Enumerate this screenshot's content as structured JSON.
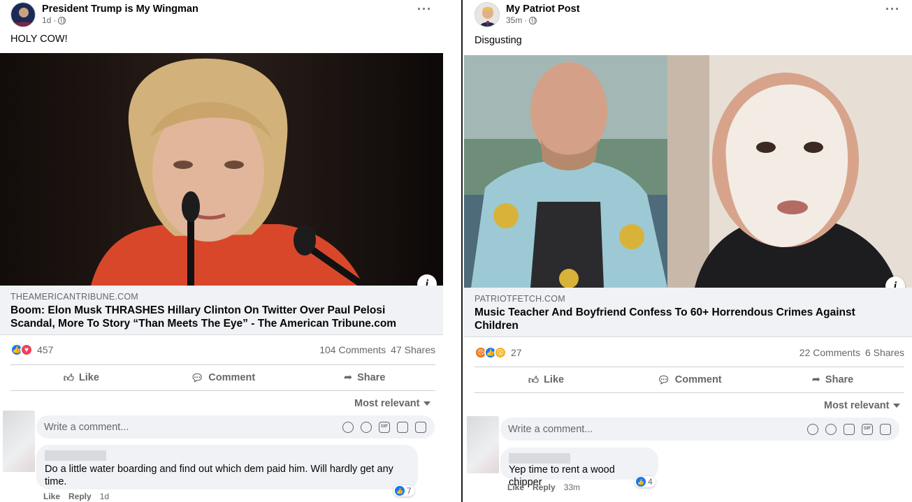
{
  "left": {
    "page_name": "President Trump is My Wingman",
    "time": "1d",
    "caption": "HOLY COW!",
    "link_domain": "THEAMERICANTRIBUNE.COM",
    "headline": "Boom: Elon Musk THRASHES Hillary Clinton On Twitter Over Paul Pelosi Scandal, More To Story “Than Meets The Eye” - The American Tribune.com",
    "reactions": [
      "like",
      "love"
    ],
    "reaction_count": "457",
    "comments": "104 Comments",
    "shares": "47 Shares",
    "actions": {
      "like": "Like",
      "comment": "Comment",
      "share": "Share"
    },
    "sort_label": "Most relevant",
    "comment_placeholder": "Write a comment...",
    "comment": {
      "text": "Do a little water boarding and find out which dem paid him. Will hardly get any time.",
      "react_count": "7",
      "like": "Like",
      "reply": "Reply",
      "time": "1d"
    }
  },
  "right": {
    "page_name": "My Patriot Post",
    "time": "35m",
    "caption": "Disgusting",
    "link_domain": "PATRIOTFETCH.COM",
    "headline": "Music Teacher And Boyfriend Confess To 60+ Horrendous Crimes Against Children",
    "reactions": [
      "angry",
      "like",
      "wow"
    ],
    "reaction_count": "27",
    "comments": "22 Comments",
    "shares": "6 Shares",
    "actions": {
      "like": "Like",
      "comment": "Comment",
      "share": "Share"
    },
    "sort_label": "Most relevant",
    "comment_placeholder": "Write a comment...",
    "comment": {
      "text": "Yep time to rent a wood chipper",
      "react_count": "4",
      "like": "Like",
      "reply": "Reply",
      "time": "33m"
    }
  },
  "colors": {
    "facebook_blue": "#1877f2",
    "love_red": "#f33e58",
    "angry_orange": "#e9710f",
    "wow_yellow": "#f7b125",
    "meta_gray": "#65676b",
    "surface_gray": "#f0f2f5"
  }
}
